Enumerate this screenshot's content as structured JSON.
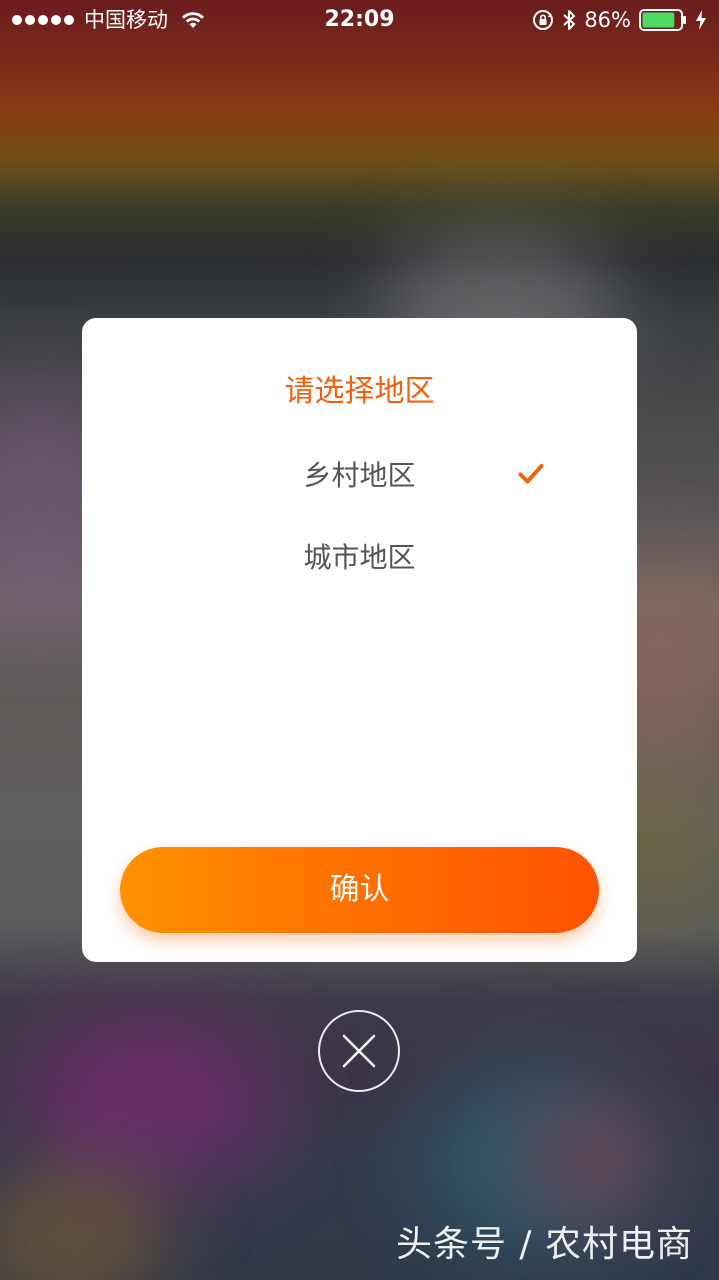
{
  "status_bar": {
    "carrier": "中国移动",
    "time": "22:09",
    "battery_percent": "86%",
    "battery_level": 0.86,
    "icons": [
      "signal-dots",
      "wifi-icon",
      "rotation-lock-icon",
      "bluetooth-icon",
      "battery-icon",
      "charging-bolt-icon"
    ]
  },
  "dialog": {
    "title": "请选择地区",
    "options": [
      {
        "label": "乡村地区",
        "selected": true
      },
      {
        "label": "城市地区",
        "selected": false
      }
    ],
    "confirm_label": "确认",
    "accent_color": "#f2610f"
  },
  "close_icon": "close-icon",
  "watermark": "头条号 / 农村电商"
}
